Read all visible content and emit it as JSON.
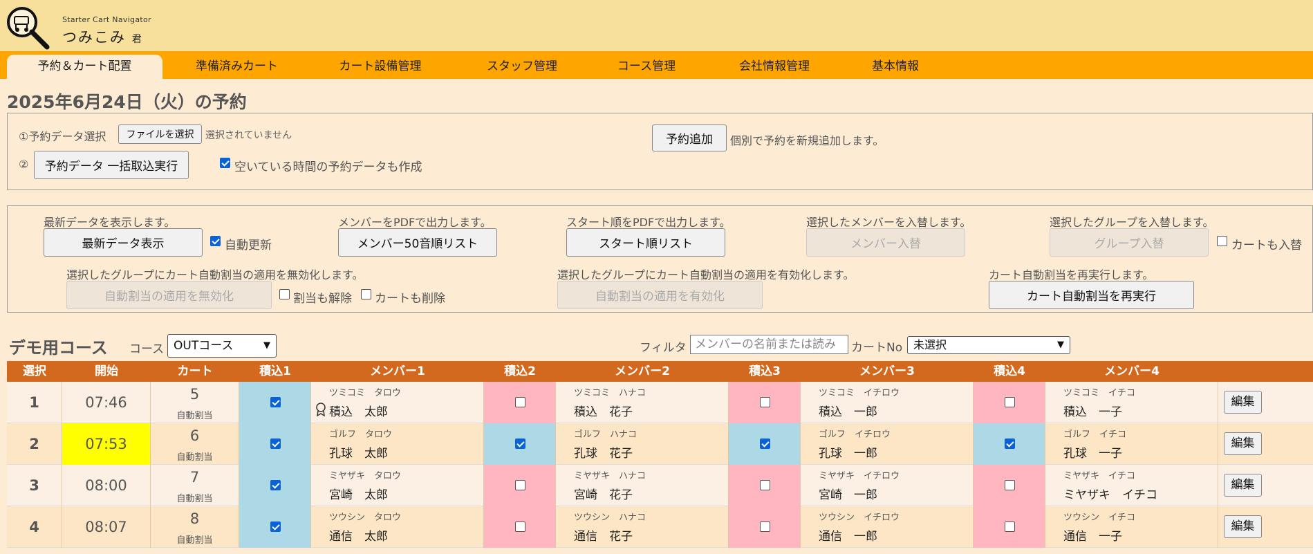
{
  "header": {
    "sub_title": "Starter Cart Navigator",
    "name_main": "つみこみ",
    "name_suffix": "君"
  },
  "nav": [
    "予約＆カート配置",
    "準備済みカート",
    "カート設備管理",
    "スタッフ管理",
    "コース管理",
    "会社情報管理",
    "基本情報"
  ],
  "page_title": "2025年6月24日（火）の予約",
  "import": {
    "step1_label": "①予約データ選択",
    "file_button": "ファイルを選択",
    "file_status": "選択されていません",
    "step2_label": "②",
    "bulk_button": "予約データ 一括取込実行",
    "empty_checkbox": "空いている時間の予約データも作成",
    "add_button": "予約追加",
    "add_desc": "個別で予約を新規追加します。"
  },
  "actions": {
    "refresh_desc": "最新データを表示します。",
    "refresh_button": "最新データ表示",
    "auto_update": "自動更新",
    "pdf_member_desc": "メンバーをPDFで出力します。",
    "pdf_member_button": "メンバー50音順リスト",
    "pdf_start_desc": "スタート順をPDFで出力します。",
    "pdf_start_button": "スタート順リスト",
    "swap_member_desc": "選択したメンバーを入替します。",
    "swap_member_button": "メンバー入替",
    "swap_group_desc": "選択したグループを入替します。",
    "swap_group_button": "グループ入替",
    "swap_cart": "カートも入替",
    "disable_desc": "選択したグループにカート自動割当の適用を無効化します。",
    "disable_button": "自動割当の適用を無効化",
    "release_assign": "割当も解除",
    "delete_cart": "カートも削除",
    "enable_desc": "選択したグループにカート自動割当の適用を有効化します。",
    "enable_button": "自動割当の適用を有効化",
    "rerun_desc": "カート自動割当を再実行します。",
    "rerun_button": "カート自動割当を再実行"
  },
  "course": {
    "title": "デモ用コース",
    "course_label": "コース",
    "course_value": "OUTコース",
    "filter_label": "フィルタ",
    "filter_placeholder": "メンバーの名前または読み",
    "cart_label": "カートNo",
    "cart_value": "未選択"
  },
  "table": {
    "headers": [
      "選択",
      "開始",
      "カート",
      "積込1",
      "メンバー1",
      "積込2",
      "メンバー2",
      "積込3",
      "メンバー3",
      "積込4",
      "メンバー4"
    ],
    "cart_note": "自動割当",
    "edit_label": "編集",
    "rows": [
      {
        "no": "1",
        "time": "07:46",
        "cart": "5",
        "highlight": false,
        "loads": [
          true,
          false,
          false,
          false
        ],
        "members": [
          {
            "kana": "ツミコミ　タロウ",
            "name": "積込　太郎"
          },
          {
            "kana": "ツミコミ　ハナコ",
            "name": "積込　花子"
          },
          {
            "kana": "ツミコミ　イチロウ",
            "name": "積込　一郎"
          },
          {
            "kana": "ツミコミ　イチコ",
            "name": "積込　一子"
          }
        ]
      },
      {
        "no": "2",
        "time": "07:53",
        "cart": "6",
        "highlight": true,
        "loads": [
          true,
          true,
          true,
          true
        ],
        "members": [
          {
            "kana": "ゴルフ　タロウ",
            "name": "孔球　太郎"
          },
          {
            "kana": "ゴルフ　ハナコ",
            "name": "孔球　花子"
          },
          {
            "kana": "ゴルフ　イチロウ",
            "name": "孔球　一郎"
          },
          {
            "kana": "ゴルフ　イチコ",
            "name": "孔球　一子"
          }
        ]
      },
      {
        "no": "3",
        "time": "08:00",
        "cart": "7",
        "highlight": false,
        "loads": [
          true,
          false,
          false,
          false
        ],
        "members": [
          {
            "kana": "ミヤザキ　タロウ",
            "name": "宮崎　太郎"
          },
          {
            "kana": "ミヤザキ　ハナコ",
            "name": "宮崎　花子"
          },
          {
            "kana": "ミヤザキ　イチロウ",
            "name": "宮崎　一郎"
          },
          {
            "kana": "ミヤザキ　イチコ",
            "name": "ミヤザキ　イチコ"
          }
        ]
      },
      {
        "no": "4",
        "time": "08:07",
        "cart": "8",
        "highlight": false,
        "loads": [
          true,
          false,
          false,
          false
        ],
        "members": [
          {
            "kana": "ツウシン　タロウ",
            "name": "通信　太郎"
          },
          {
            "kana": "ツウシン　ハナコ",
            "name": "通信　花子"
          },
          {
            "kana": "ツウシン　イチロウ",
            "name": "通信　一郎"
          },
          {
            "kana": "ツウシン　イチコ",
            "name": "通信　一子"
          }
        ]
      }
    ]
  }
}
